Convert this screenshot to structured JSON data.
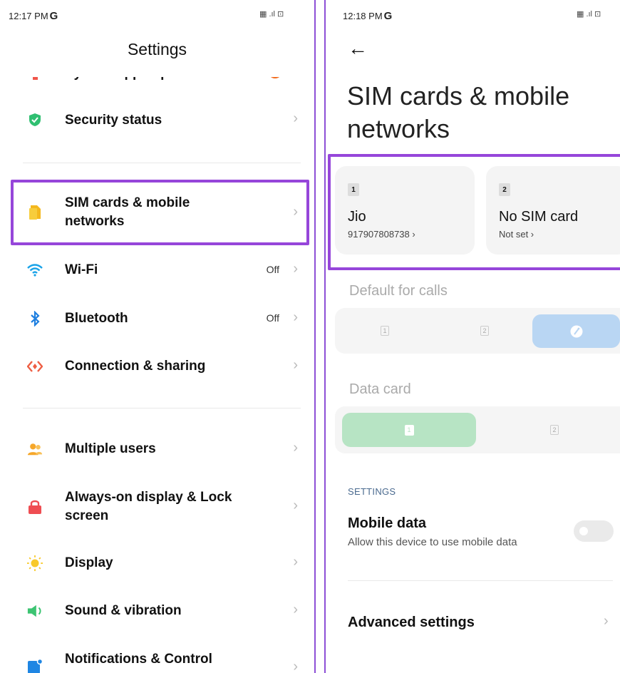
{
  "left": {
    "status_time": "12:17 PM",
    "carrier": "G",
    "status_icons": "▦ .ıl ⊡",
    "title": "Settings",
    "items": [
      {
        "label": "System apps updater",
        "value": "",
        "icon": "update-icon"
      },
      {
        "label": "Security status",
        "value": "",
        "icon": "shield-check-icon"
      },
      {
        "label": "SIM cards & mobile networks",
        "value": "",
        "icon": "sim-icon"
      },
      {
        "label": "Wi-Fi",
        "value": "Off",
        "icon": "wifi-icon"
      },
      {
        "label": "Bluetooth",
        "value": "Off",
        "icon": "bluetooth-icon"
      },
      {
        "label": "Connection & sharing",
        "value": "",
        "icon": "connection-icon"
      },
      {
        "label": "Multiple users",
        "value": "",
        "icon": "users-icon"
      },
      {
        "label": "Always-on display & Lock screen",
        "value": "",
        "icon": "lock-icon"
      },
      {
        "label": "Display",
        "value": "",
        "icon": "sun-icon"
      },
      {
        "label": "Sound & vibration",
        "value": "",
        "icon": "speaker-icon"
      },
      {
        "label": "Notifications & Control",
        "value": "",
        "icon": "notification-icon"
      }
    ],
    "chevron": "›"
  },
  "right": {
    "status_time": "12:18 PM",
    "carrier": "G",
    "status_icons": "▦ .ıl ⊡",
    "back": "←",
    "title": "SIM cards & mobile networks",
    "sims": [
      {
        "slot": "1",
        "name": "Jio",
        "sub": "917907808738 ›"
      },
      {
        "slot": "2",
        "name": "No SIM card",
        "sub": "Not set ›"
      }
    ],
    "default_calls_label": "Default for calls",
    "data_card_label": "Data card",
    "seg_one": "1",
    "seg_two": "2",
    "settings_caption": "SETTINGS",
    "mobile_data_title": "Mobile data",
    "mobile_data_sub": "Allow this device to use mobile data",
    "advanced": "Advanced settings",
    "chevron": "›"
  },
  "colors": {
    "highlight": "#9646da",
    "calls_selected": "#b9d6f3",
    "data_selected": "#b7e4c4"
  }
}
